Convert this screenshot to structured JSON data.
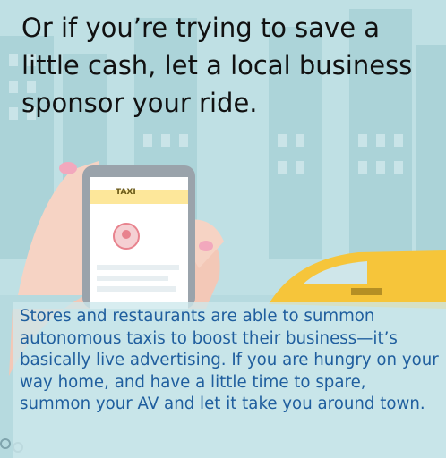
{
  "headline": "Or if you’re trying to save a little cash, let a local business sponsor your ride.",
  "caption": "Stores and restaurants are able to summon autonomous taxis to boost their business—it’s basically live advertising. If you are hungry on your way home, and have a little time to spare, summon your AV and let it take you around town.",
  "phone_screen_label": "TAXI",
  "colors": {
    "background": "#bfe0e4",
    "buildings": "#a9d2d8",
    "hand_skin": "#f6d3c4",
    "taxi_yellow": "#f6c53a",
    "caption_text": "#1f5e9e",
    "headline_text": "#111111"
  }
}
